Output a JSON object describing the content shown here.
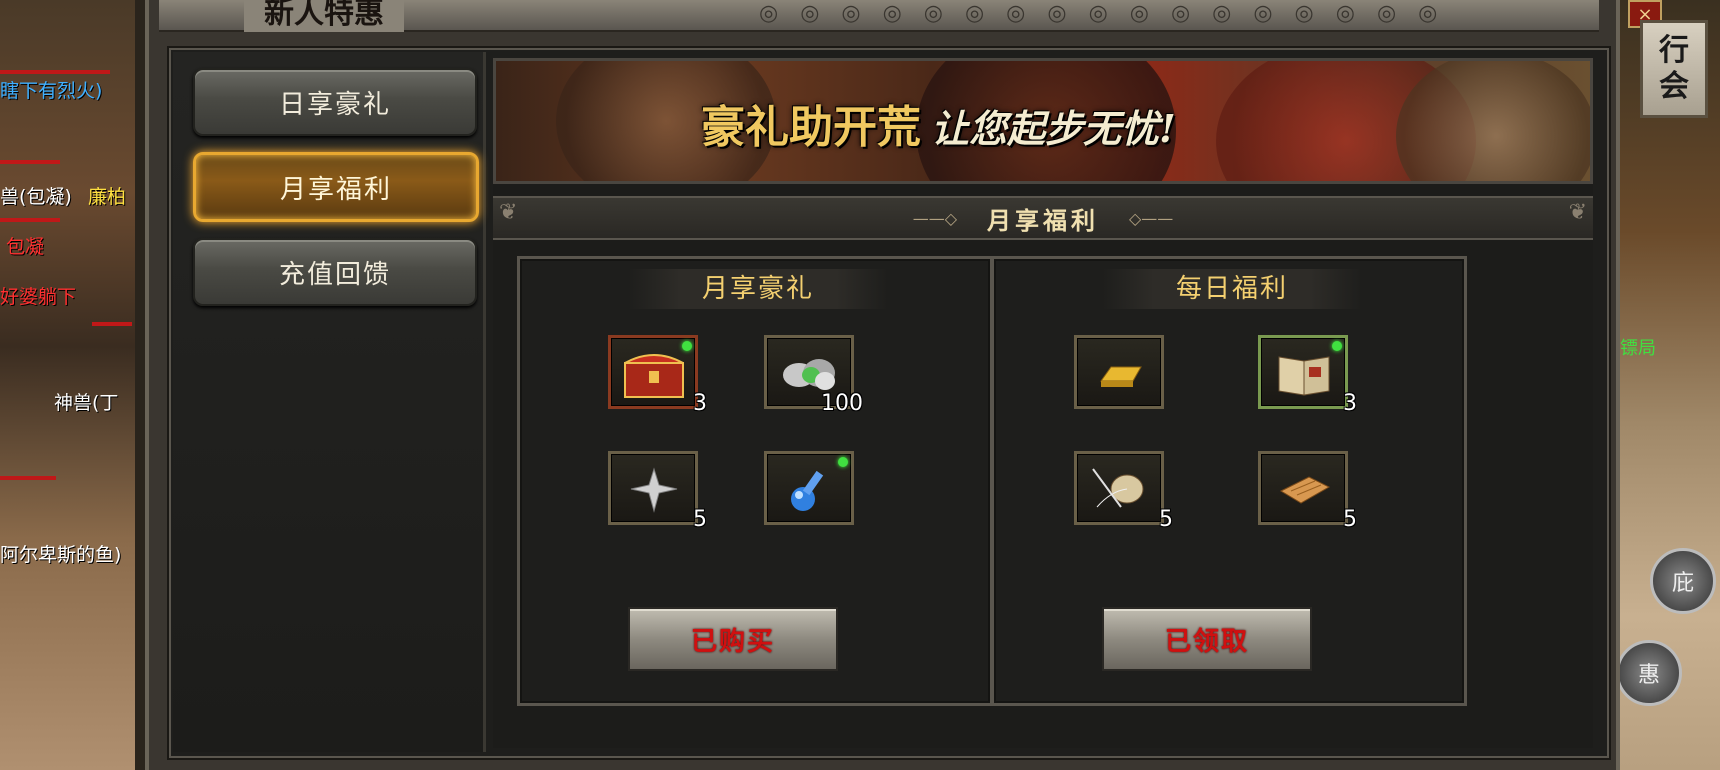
{
  "window": {
    "title": "新人特惠",
    "close_label": "×"
  },
  "sidebar": {
    "tabs": [
      {
        "label": "日享豪礼",
        "active": false
      },
      {
        "label": "月享福利",
        "active": true
      },
      {
        "label": "充值回馈",
        "active": false
      }
    ]
  },
  "banner": {
    "headline": "豪礼助开荒",
    "tagline": "让您起步无忧!"
  },
  "section": {
    "title": "月享福利"
  },
  "monthly_box": {
    "title": "月享豪礼",
    "items": [
      {
        "icon": "red-treasure-chest-icon",
        "qty": "3"
      },
      {
        "icon": "silver-ore-icon",
        "qty": "100"
      },
      {
        "icon": "shuriken-icon",
        "qty": "5"
      },
      {
        "icon": "blue-potion-icon",
        "qty": ""
      }
    ],
    "button_label": "已购买"
  },
  "daily_box": {
    "title": "每日福利",
    "items": [
      {
        "icon": "gold-bar-icon",
        "qty": ""
      },
      {
        "icon": "skill-book-icon",
        "qty": "3"
      },
      {
        "icon": "silk-thread-spool-icon",
        "qty": "5"
      },
      {
        "icon": "scroll-icon",
        "qty": "5"
      }
    ],
    "button_label": "已领取"
  },
  "game_world": {
    "guild_button": [
      "行",
      "会"
    ],
    "player_names": [
      "瞎下有烈火)",
      "兽(包凝)",
      "廉柏",
      "包凝",
      "好婆躺下",
      "神兽(丁",
      "阿尔卑斯的鱼)",
      "镖局"
    ],
    "minimap_labels": [
      "庇",
      "惠"
    ]
  },
  "colors": {
    "gold_text": "#f4d070",
    "button_red_text": "#d01010",
    "active_tab_glow": "#e8a830"
  }
}
